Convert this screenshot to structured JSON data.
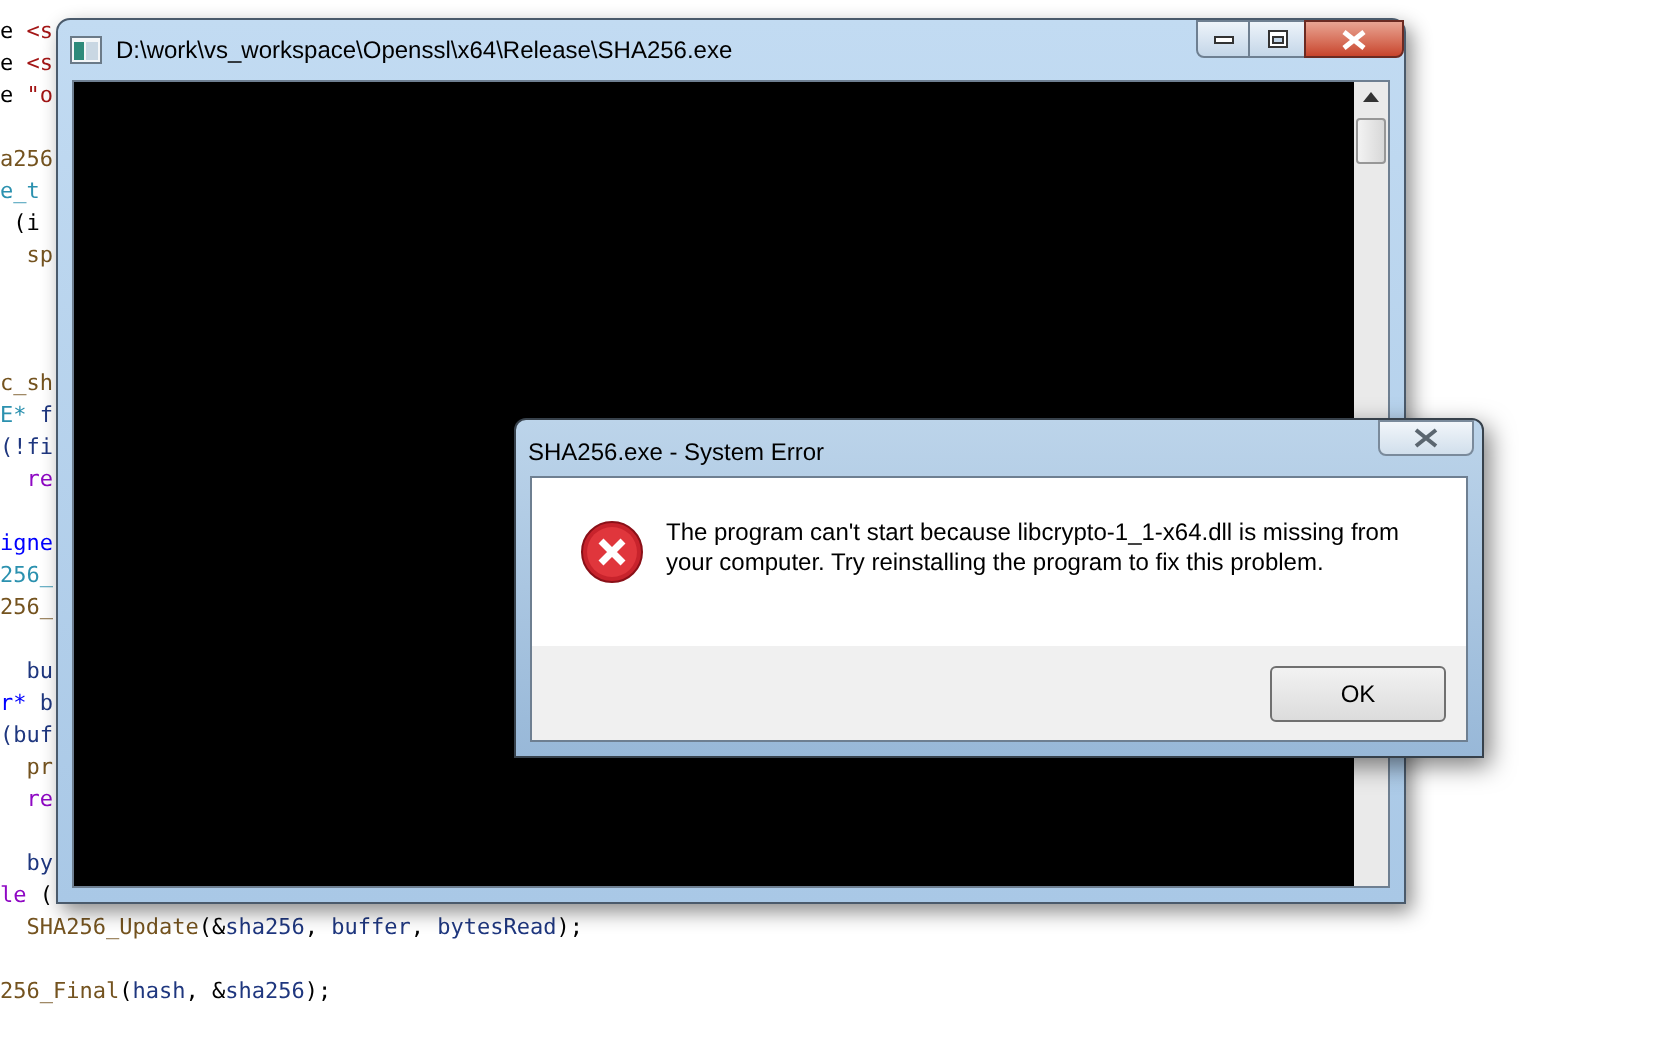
{
  "editor": {
    "lines": [
      {
        "kind": "code",
        "tokens": [
          {
            "text": "e ",
            "kind": "plain"
          },
          {
            "text": "<s",
            "kind": "string"
          }
        ]
      },
      {
        "kind": "code",
        "tokens": [
          {
            "text": "e ",
            "kind": "plain"
          },
          {
            "text": "<s",
            "kind": "string"
          }
        ]
      },
      {
        "kind": "code",
        "tokens": [
          {
            "text": "e ",
            "kind": "plain"
          },
          {
            "text": "\"o",
            "kind": "string"
          }
        ]
      },
      {
        "kind": "blank"
      },
      {
        "kind": "code",
        "tokens": [
          {
            "text": "a256",
            "kind": "func"
          }
        ]
      },
      {
        "kind": "code",
        "tokens": [
          {
            "text": "e_t",
            "kind": "type"
          }
        ]
      },
      {
        "kind": "code",
        "tokens": [
          {
            "text": " (i",
            "kind": "plain"
          }
        ]
      },
      {
        "kind": "code",
        "tokens": [
          {
            "text": "  sp",
            "kind": "func"
          }
        ]
      },
      {
        "kind": "blank"
      },
      {
        "kind": "blank"
      },
      {
        "kind": "blank"
      },
      {
        "kind": "code",
        "tokens": [
          {
            "text": "c_sh",
            "kind": "func"
          }
        ]
      },
      {
        "kind": "code",
        "tokens": [
          {
            "text": "E*",
            "kind": "type"
          },
          {
            "text": " f",
            "kind": "var"
          }
        ]
      },
      {
        "kind": "code",
        "tokens": [
          {
            "text": "(!fi",
            "kind": "var"
          }
        ]
      },
      {
        "kind": "code",
        "tokens": [
          {
            "text": "  re",
            "kind": "keyword"
          }
        ]
      },
      {
        "kind": "blank"
      },
      {
        "kind": "code",
        "tokens": [
          {
            "text": "igne",
            "kind": "builtin"
          }
        ]
      },
      {
        "kind": "code",
        "tokens": [
          {
            "text": "256_",
            "kind": "type"
          }
        ]
      },
      {
        "kind": "code",
        "tokens": [
          {
            "text": "256_",
            "kind": "func"
          }
        ]
      },
      {
        "kind": "blank"
      },
      {
        "kind": "code",
        "tokens": [
          {
            "text": "  bu",
            "kind": "var"
          }
        ]
      },
      {
        "kind": "code",
        "tokens": [
          {
            "text": "r*",
            "kind": "builtin"
          },
          {
            "text": " b",
            "kind": "var"
          }
        ]
      },
      {
        "kind": "code",
        "tokens": [
          {
            "text": "(buf",
            "kind": "var"
          }
        ]
      },
      {
        "kind": "code",
        "tokens": [
          {
            "text": "  pr",
            "kind": "func"
          }
        ]
      },
      {
        "kind": "code",
        "tokens": [
          {
            "text": "  re",
            "kind": "keyword"
          }
        ]
      },
      {
        "kind": "blank"
      },
      {
        "kind": "code",
        "tokens": [
          {
            "text": "  by",
            "kind": "var"
          }
        ]
      },
      {
        "kind": "code",
        "tokens": [
          {
            "text": "le",
            "kind": "keyword"
          },
          {
            "text": " (",
            "kind": "plain"
          }
        ]
      },
      {
        "kind": "code",
        "tokens": [
          {
            "text": "  SHA256_Update",
            "kind": "func"
          },
          {
            "text": "(&",
            "kind": "plain"
          },
          {
            "text": "sha256",
            "kind": "var"
          },
          {
            "text": ", ",
            "kind": "plain"
          },
          {
            "text": "buffer",
            "kind": "var"
          },
          {
            "text": ", ",
            "kind": "plain"
          },
          {
            "text": "bytesRead",
            "kind": "var"
          },
          {
            "text": ");",
            "kind": "plain"
          }
        ]
      },
      {
        "kind": "blank"
      },
      {
        "kind": "code",
        "tokens": [
          {
            "text": "256_Final",
            "kind": "func"
          },
          {
            "text": "(",
            "kind": "plain"
          },
          {
            "text": "hash",
            "kind": "var"
          },
          {
            "text": ", &",
            "kind": "plain"
          },
          {
            "text": "sha256",
            "kind": "var"
          },
          {
            "text": ");",
            "kind": "plain"
          }
        ]
      }
    ]
  },
  "console_window": {
    "title": "D:\\work\\vs_workspace\\Openssl\\x64\\Release\\SHA256.exe"
  },
  "dialog": {
    "title": "SHA256.exe - System Error",
    "message": "The program can't start because libcrypto-1_1-x64.dll is missing from your computer. Try reinstalling the program to fix this problem.",
    "buttons": [
      "OK"
    ]
  }
}
